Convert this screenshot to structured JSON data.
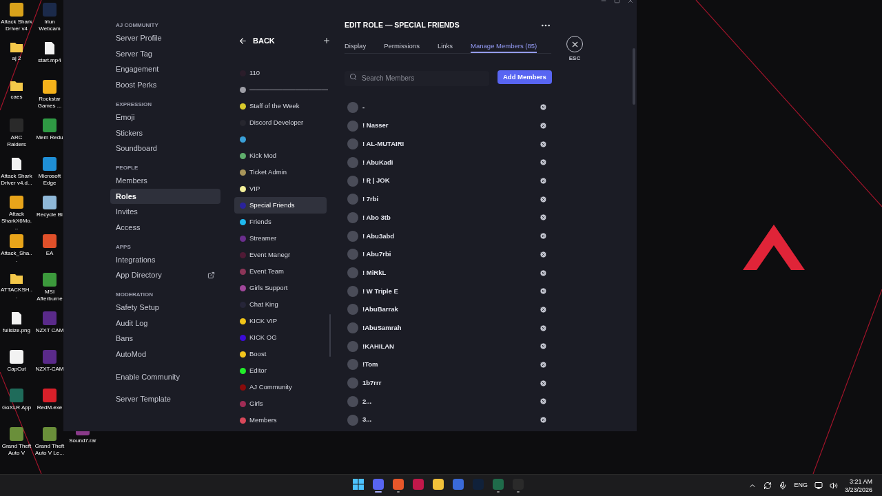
{
  "desktop_columns": [
    [
      {
        "label": "Attack Shark Driver v4",
        "kind": "app",
        "color": "#d9a21b"
      },
      {
        "label": "aj 2",
        "kind": "folder"
      },
      {
        "label": "caes",
        "kind": "folder"
      },
      {
        "label": "ARC Raiders",
        "kind": "app",
        "color": "#2a2a2a"
      },
      {
        "label": "Attack Shark Driver v4.d...",
        "kind": "file"
      },
      {
        "label": "Attack SharkX6Mo...",
        "kind": "app",
        "color": "#e8a41a"
      },
      {
        "label": "Attack_Sha...",
        "kind": "app",
        "color": "#e8a41a"
      },
      {
        "label": "ATTACKSH...",
        "kind": "folder"
      },
      {
        "label": "fullsize.png",
        "kind": "file"
      },
      {
        "label": "CapCut",
        "kind": "app",
        "color": "#f2f2f2"
      },
      {
        "label": "GoXLR App",
        "kind": "app",
        "color": "#1f6b5a"
      },
      {
        "label": "Grand Theft Auto V",
        "kind": "app",
        "color": "#6a8f3a"
      }
    ],
    [
      {
        "label": "Iriun Webcam",
        "kind": "app",
        "color": "#1b2a4a"
      },
      {
        "label": "start.mp4",
        "kind": "file"
      },
      {
        "label": "Rockstar Games ...",
        "kind": "app",
        "color": "#f5b21b"
      },
      {
        "label": "Mem Redu",
        "kind": "app",
        "color": "#2f9a44"
      },
      {
        "label": "Microsoft Edge",
        "kind": "app",
        "color": "#1f8fd6"
      },
      {
        "label": "Recycle Bi",
        "kind": "app",
        "color": "#8fb8d8"
      },
      {
        "label": "EA",
        "kind": "app",
        "color": "#e0502a"
      },
      {
        "label": "MSI Afterburne",
        "kind": "app",
        "color": "#3c9a3c"
      },
      {
        "label": "NZXT CAM",
        "kind": "app",
        "color": "#5a2a8a"
      },
      {
        "label": "NZXT-CAM",
        "kind": "app",
        "color": "#5a2a8a"
      },
      {
        "label": "RedM.exe",
        "kind": "app",
        "color": "#d8202a"
      },
      {
        "label": "Grand Theft Auto V Le...",
        "kind": "app",
        "color": "#6a8f3a"
      }
    ],
    [
      {
        "label": "Sound7.rar",
        "kind": "app",
        "color": "#8a3a8a"
      }
    ]
  ],
  "sidebar": {
    "sections": [
      {
        "heading": "AJ COMMUNITY",
        "items": [
          {
            "label": "Server Profile",
            "selected": false
          },
          {
            "label": "Server Tag",
            "selected": false
          },
          {
            "label": "Engagement",
            "selected": false
          },
          {
            "label": "Boost Perks",
            "selected": false
          }
        ]
      },
      {
        "heading": "EXPRESSION",
        "items": [
          {
            "label": "Emoji",
            "selected": false
          },
          {
            "label": "Stickers",
            "selected": false
          },
          {
            "label": "Soundboard",
            "selected": false
          }
        ]
      },
      {
        "heading": "PEOPLE",
        "items": [
          {
            "label": "Members",
            "selected": false
          },
          {
            "label": "Roles",
            "selected": true
          },
          {
            "label": "Invites",
            "selected": false
          },
          {
            "label": "Access",
            "selected": false
          }
        ]
      },
      {
        "heading": "APPS",
        "items": [
          {
            "label": "Integrations",
            "selected": false
          },
          {
            "label": "App Directory",
            "selected": false,
            "external": true
          }
        ]
      },
      {
        "heading": "MODERATION",
        "items": [
          {
            "label": "Safety Setup",
            "selected": false
          },
          {
            "label": "Audit Log",
            "selected": false
          },
          {
            "label": "Bans",
            "selected": false
          },
          {
            "label": "AutoMod",
            "selected": false
          }
        ]
      },
      {
        "items": [
          {
            "label": "Enable Community",
            "selected": false
          }
        ]
      },
      {
        "items": [
          {
            "label": "Server Template",
            "selected": false
          }
        ]
      }
    ]
  },
  "roles": {
    "back_label": "BACK",
    "items": [
      {
        "name": "110",
        "color": "#2a1d2a",
        "selected": false
      },
      {
        "name": "————————————",
        "color": "#9e9ea6",
        "selected": false
      },
      {
        "name": "Staff of the Week",
        "color": "#d7c92b",
        "selected": false
      },
      {
        "name": "Discord Developer",
        "color": "#26262e",
        "selected": false
      },
      {
        "color": "#3aa0d8",
        "selected": false
      },
      {
        "name": "Kick Mod",
        "color": "#5fae6c",
        "selected": false
      },
      {
        "name": "Ticket Admin",
        "color": "#a8955a",
        "selected": false
      },
      {
        "name": "VIP",
        "color": "#f3ef9a",
        "selected": false
      },
      {
        "name": "Special Friends",
        "color": "#2a239c",
        "selected": true
      },
      {
        "name": "Friends",
        "color": "#1fb9ef",
        "selected": false
      },
      {
        "name": "Streamer",
        "color": "#6b2e8d",
        "selected": false
      },
      {
        "name": "Event Manegr",
        "color": "#4f1a35",
        "selected": false
      },
      {
        "name": "Event Team",
        "color": "#8c3558",
        "selected": false
      },
      {
        "name": "Girls Support",
        "color": "#a0479a",
        "selected": false
      },
      {
        "name": "Chat King",
        "color": "#262538",
        "selected": false
      },
      {
        "name": "KICK VIP",
        "color": "#f0c419",
        "selected": false
      },
      {
        "name": "KICK OG",
        "color": "#3c0cd8",
        "selected": false
      },
      {
        "name": "Boost",
        "color": "#f1c41c",
        "selected": false
      },
      {
        "name": "Editor",
        "color": "#22ee2a",
        "selected": false
      },
      {
        "name": "AJ Community",
        "color": "#8a0b0b",
        "selected": false
      },
      {
        "name": "Girls",
        "color": "#a02c55",
        "selected": false
      },
      {
        "name": "Members",
        "color": "#d8485a",
        "selected": false
      }
    ]
  },
  "editor": {
    "title": "EDIT ROLE — SPECIAL FRIENDS",
    "tabs": [
      {
        "label": "Display",
        "selected": false
      },
      {
        "label": "Permissions",
        "selected": false
      },
      {
        "label": "Links",
        "selected": false
      },
      {
        "label": "Manage Members (85)",
        "selected": true
      }
    ],
    "esc_label": "ESC",
    "search": {
      "placeholder": "Search Members"
    },
    "add_button": "Add Members",
    "members": [
      {
        "name": "-"
      },
      {
        "name": "! Nasser"
      },
      {
        "name": "! AL-MUTAIRI"
      },
      {
        "name": "! AbuKadi"
      },
      {
        "name": "! Ʀ | JOK"
      },
      {
        "name": "! 7rbi"
      },
      {
        "name": "! Abo 3tb"
      },
      {
        "name": "! Abu3abd"
      },
      {
        "name": "! Abu7rbi"
      },
      {
        "name": "! MiRkL"
      },
      {
        "name": "! W Triple E"
      },
      {
        "name": "!AbuBarrak"
      },
      {
        "name": "!AbuSamrah"
      },
      {
        "name": "!KAHILAN"
      },
      {
        "name": "!Tom"
      },
      {
        "name": "1b7rrr"
      },
      {
        "name": "2..."
      },
      {
        "name": "3..."
      }
    ]
  },
  "taskbar": {
    "apps": [
      {
        "kind": "start",
        "running": false
      },
      {
        "kind": "app",
        "color": "#5865f2",
        "running": true,
        "focused": true
      },
      {
        "kind": "app",
        "color": "#e8572a",
        "running": true,
        "focused": false
      },
      {
        "kind": "app",
        "color": "#c2184a",
        "running": false
      },
      {
        "kind": "app",
        "color": "#f2c13a",
        "running": false
      },
      {
        "kind": "app",
        "color": "#3a6ad8",
        "running": false
      },
      {
        "kind": "app",
        "color": "#10213a",
        "running": false
      },
      {
        "kind": "app",
        "color": "#1f6b4a",
        "running": true,
        "focused": false
      },
      {
        "kind": "app",
        "color": "#2a2a2a",
        "running": true,
        "focused": false
      }
    ],
    "language": "ENG",
    "time": "3:21 AM",
    "date": "3/23/2026"
  }
}
